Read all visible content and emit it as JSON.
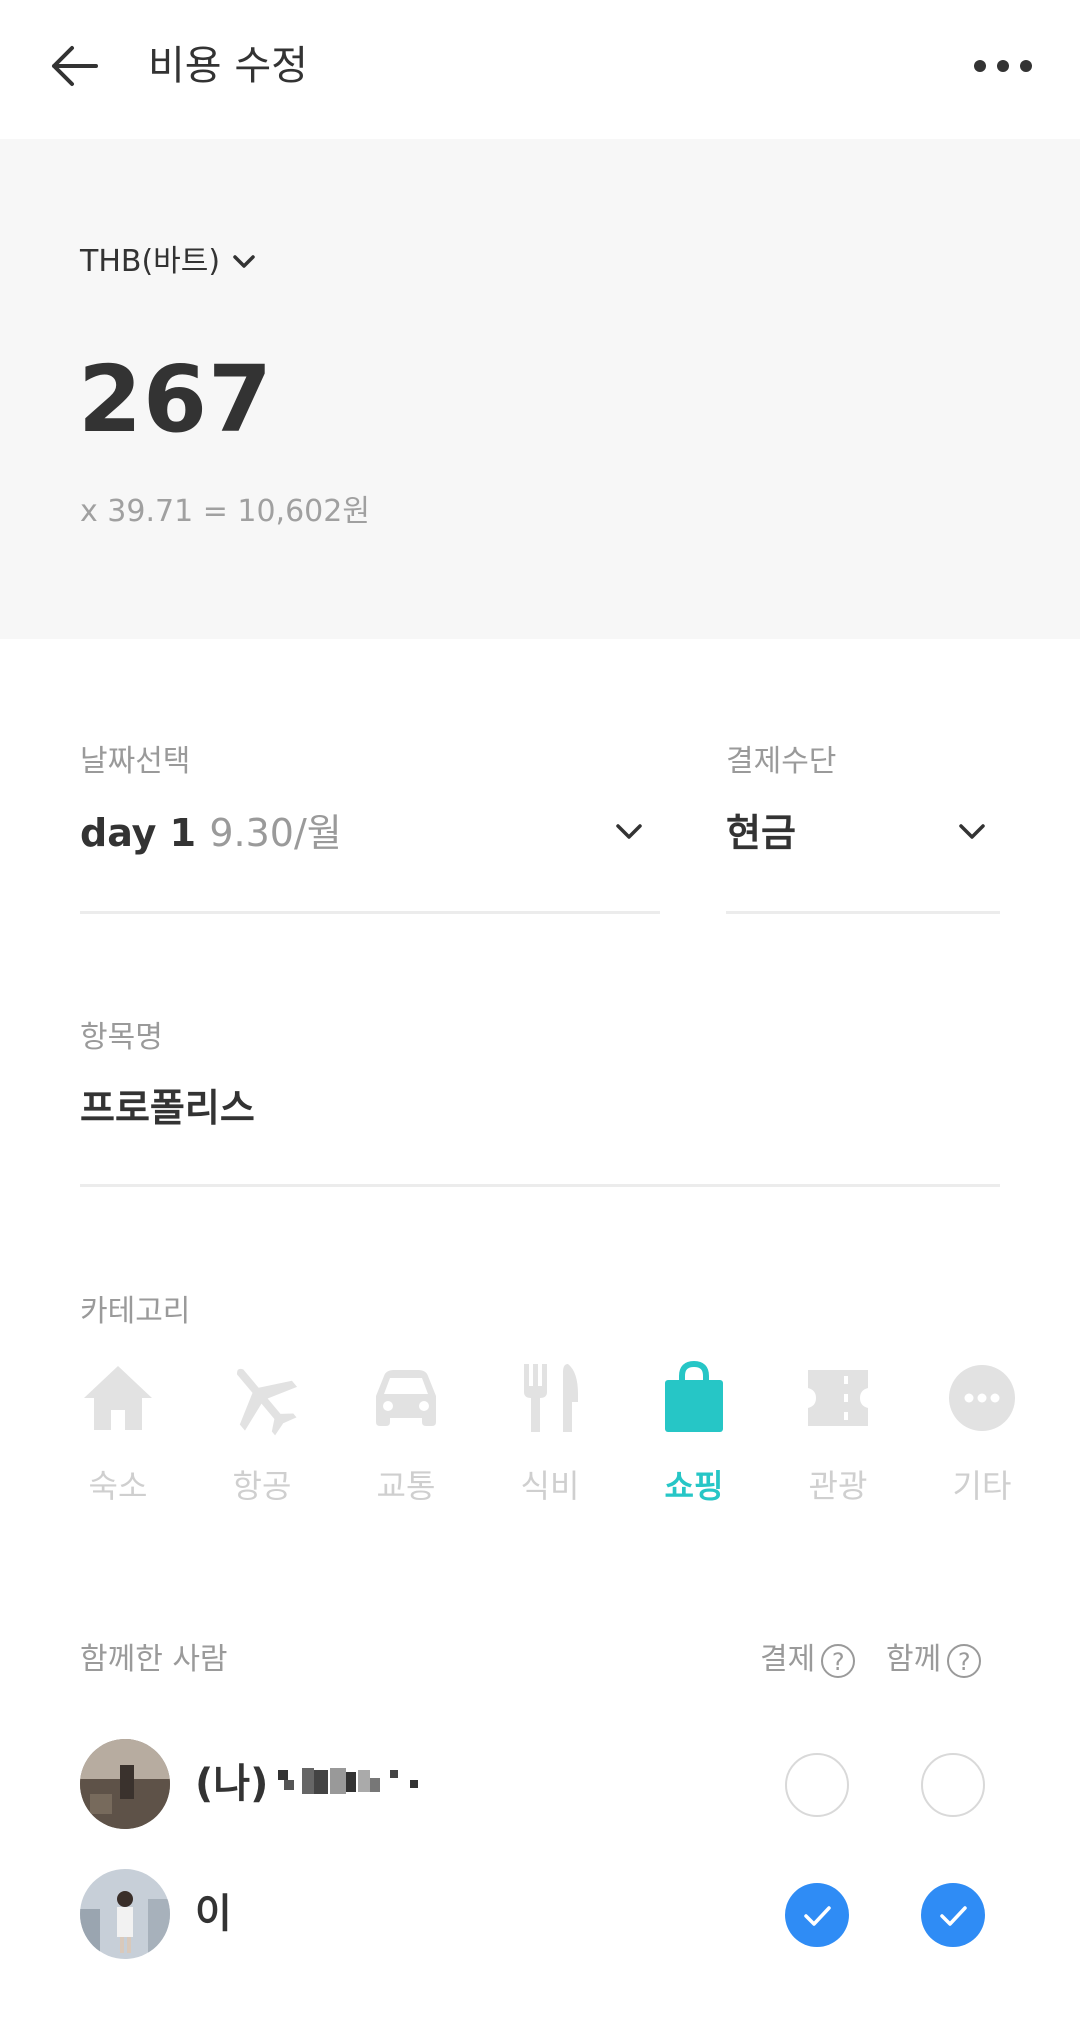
{
  "header": {
    "title": "비용 수정"
  },
  "amount_panel": {
    "currency": "THB(바트)",
    "amount": "267",
    "conversion": "x 39.71 = 10,602원"
  },
  "date_field": {
    "label": "날짜선택",
    "day": "day 1",
    "date": "9.30/월"
  },
  "payment_field": {
    "label": "결제수단",
    "value": "현금"
  },
  "item_field": {
    "label": "항목명",
    "value": "프로폴리스"
  },
  "category": {
    "label": "카테고리",
    "selected": "쇼핑",
    "items": [
      {
        "label": "숙소",
        "icon": "house-icon"
      },
      {
        "label": "항공",
        "icon": "airplane-icon"
      },
      {
        "label": "교통",
        "icon": "car-icon"
      },
      {
        "label": "식비",
        "icon": "fork-knife-icon"
      },
      {
        "label": "쇼핑",
        "icon": "shopping-bag-icon"
      },
      {
        "label": "관광",
        "icon": "ticket-icon"
      },
      {
        "label": "기타",
        "icon": "more-circle-icon"
      }
    ]
  },
  "companions": {
    "label": "함께한 사람",
    "pay_header": "결제",
    "with_header": "함께",
    "people": [
      {
        "name": "(나)",
        "paid": false,
        "together": false
      },
      {
        "name": "이",
        "paid": true,
        "together": true
      }
    ]
  },
  "colors": {
    "accent": "#26c6c6",
    "check_blue": "#2f8cf5",
    "panel_bg": "#f7f7f7",
    "inactive_icon": "#e2e2e2"
  }
}
